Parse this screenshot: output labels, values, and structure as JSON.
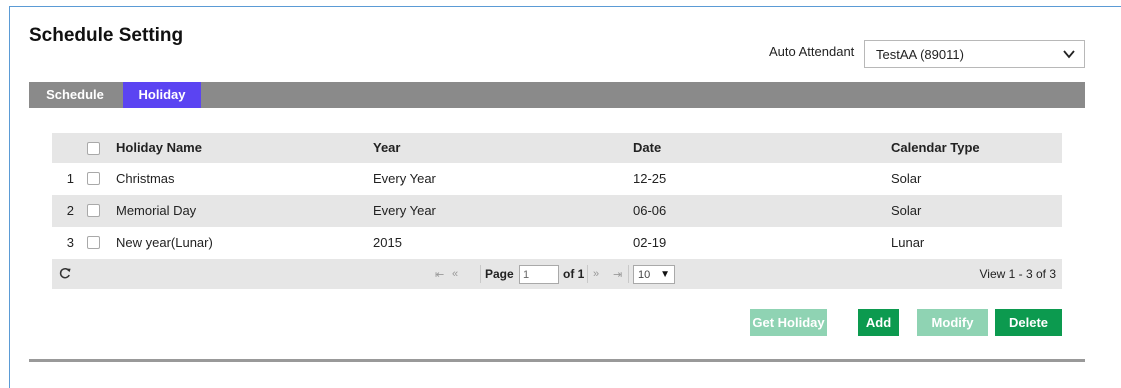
{
  "page": {
    "title": "Schedule Setting"
  },
  "auto_attendant": {
    "label": "Auto Attendant",
    "value": "TestAA (89011)"
  },
  "tabs": [
    {
      "label": "Schedule",
      "active": false
    },
    {
      "label": "Holiday",
      "active": true
    }
  ],
  "grid": {
    "headers": {
      "name": "Holiday Name",
      "year": "Year",
      "date": "Date",
      "calendar": "Calendar Type"
    },
    "rows": [
      {
        "num": "1",
        "name": "Christmas",
        "year": "Every Year",
        "date": "12-25",
        "calendar": "Solar"
      },
      {
        "num": "2",
        "name": "Memorial Day",
        "year": "Every Year",
        "date": "06-06",
        "calendar": "Solar"
      },
      {
        "num": "3",
        "name": "New year(Lunar)",
        "year": "2015",
        "date": "02-19",
        "calendar": "Lunar"
      }
    ]
  },
  "pager": {
    "page_label": "Page",
    "page_value": "1",
    "of_label": "of 1",
    "page_size": "10",
    "view_text": "View 1 - 3 of 3",
    "first_icon": "first-page-icon",
    "prev_icon": "prev-page-icon",
    "next_icon": "next-page-icon",
    "last_icon": "last-page-icon",
    "refresh_icon": "refresh-icon"
  },
  "buttons": {
    "get_holiday": "Get Holiday",
    "add": "Add",
    "modify": "Modify",
    "delete": "Delete"
  },
  "colors": {
    "active_tab": "#5b44f2",
    "tab_bar": "#8a8a8a",
    "button_enabled": "#0c9a4f",
    "button_disabled": "#8fd3b3",
    "row_alt": "#e6e6e6"
  }
}
